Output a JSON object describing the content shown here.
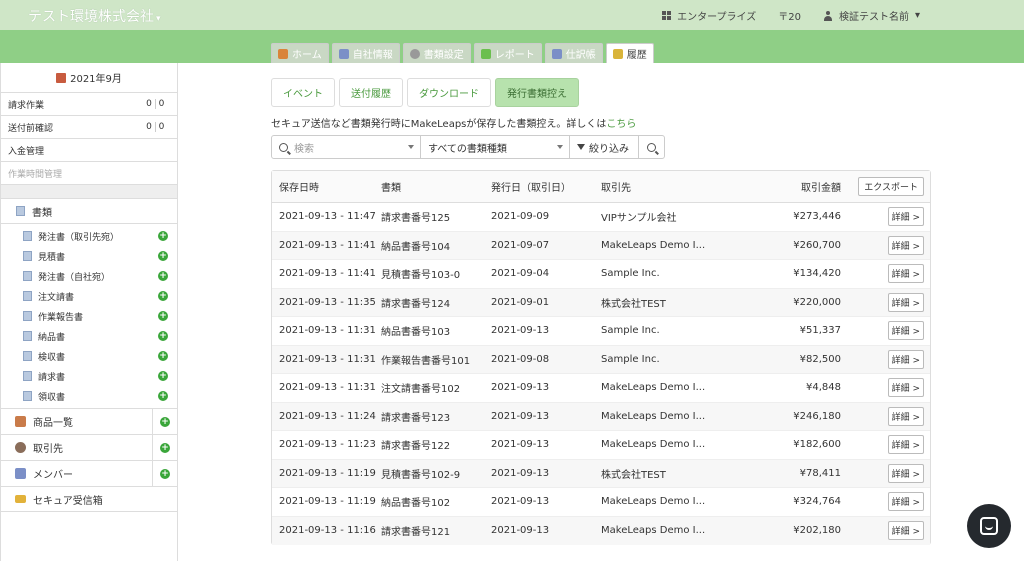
{
  "header": {
    "company": "テスト環境株式会社",
    "plan": "エンタープライズ",
    "count": "〒20",
    "user": "検証テスト名前"
  },
  "nav_tabs": [
    {
      "label": "ホーム",
      "icon": "home-icon",
      "color": "#d9843a"
    },
    {
      "label": "自社情報",
      "icon": "building-icon",
      "color": "#7b8fc7"
    },
    {
      "label": "書類設定",
      "icon": "gear-icon",
      "color": "#999999"
    },
    {
      "label": "レポート",
      "icon": "chart-icon",
      "color": "#6bbf4e"
    },
    {
      "label": "仕訳帳",
      "icon": "journal-icon",
      "color": "#7b8fc7"
    },
    {
      "label": "履歴",
      "icon": "history-icon",
      "color": "#d9b43a"
    }
  ],
  "sidebar": {
    "month": "2021年9月",
    "rows": [
      {
        "label": "請求作業",
        "a": "0",
        "b": "0"
      },
      {
        "label": "送付前確認",
        "a": "0",
        "b": "0"
      },
      {
        "label": "入金管理"
      },
      {
        "label": "作業時間管理"
      }
    ],
    "docs_title": "書類",
    "docs": [
      "発注書（取引先宛）",
      "見積書",
      "発注書（自社宛）",
      "注文請書",
      "作業報告書",
      "納品書",
      "検収書",
      "請求書",
      "領収書"
    ],
    "sections": [
      {
        "label": "商品一覧",
        "icon": "products-icon"
      },
      {
        "label": "取引先",
        "icon": "client-icon"
      },
      {
        "label": "メンバー",
        "icon": "members-icon"
      },
      {
        "label": "セキュア受信箱",
        "icon": "envelope-icon"
      }
    ]
  },
  "subtabs": [
    "イベント",
    "送付履歴",
    "ダウンロード",
    "発行書類控え"
  ],
  "description": {
    "text": "セキュア送信など書類発行時にMakeLeapsが保存した書類控え。詳しくは",
    "link": "こちら"
  },
  "filters": {
    "search_placeholder": "検索",
    "doc_type": "すべての書類種類",
    "filter_label": "絞り込み"
  },
  "table": {
    "headers": [
      "保存日時",
      "書類",
      "発行日（取引日）",
      "取引先",
      "取引金額"
    ],
    "export_label": "エクスポート",
    "detail_label": "詳細 >",
    "rows": [
      [
        "2021-09-13 - 11:47",
        "請求書番号125",
        "2021-09-09",
        "VIPサンプル会社",
        "¥273,446"
      ],
      [
        "2021-09-13 - 11:41",
        "納品書番号104",
        "2021-09-07",
        "MakeLeaps Demo I...",
        "¥260,700"
      ],
      [
        "2021-09-13 - 11:41",
        "見積書番号103-0",
        "2021-09-04",
        "Sample Inc.",
        "¥134,420"
      ],
      [
        "2021-09-13 - 11:35",
        "請求書番号124",
        "2021-09-01",
        "株式会社TEST",
        "¥220,000"
      ],
      [
        "2021-09-13 - 11:31",
        "納品書番号103",
        "2021-09-13",
        "Sample Inc.",
        "¥51,337"
      ],
      [
        "2021-09-13 - 11:31",
        "作業報告書番号101",
        "2021-09-08",
        "Sample Inc.",
        "¥82,500"
      ],
      [
        "2021-09-13 - 11:31",
        "注文請書番号102",
        "2021-09-13",
        "MakeLeaps Demo I...",
        "¥4,848"
      ],
      [
        "2021-09-13 - 11:24",
        "請求書番号123",
        "2021-09-13",
        "MakeLeaps Demo I...",
        "¥246,180"
      ],
      [
        "2021-09-13 - 11:23",
        "請求書番号122",
        "2021-09-13",
        "MakeLeaps Demo I...",
        "¥182,600"
      ],
      [
        "2021-09-13 - 11:19",
        "見積書番号102-9",
        "2021-09-13",
        "株式会社TEST",
        "¥78,411"
      ],
      [
        "2021-09-13 - 11:19",
        "納品書番号102",
        "2021-09-13",
        "MakeLeaps Demo I...",
        "¥324,764"
      ],
      [
        "2021-09-13 - 11:16",
        "請求書番号121",
        "2021-09-13",
        "MakeLeaps Demo I...",
        "¥202,180"
      ]
    ]
  }
}
